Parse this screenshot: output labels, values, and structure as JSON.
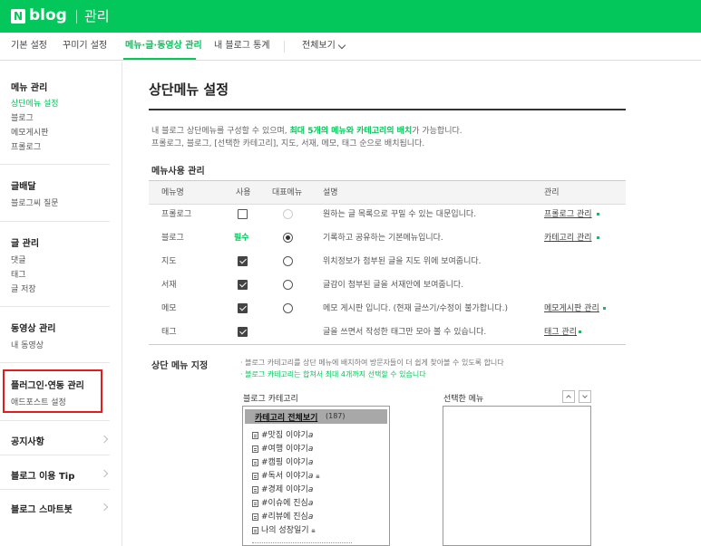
{
  "header": {
    "logo_n": "N",
    "logo_blog": "blog",
    "title": "관리"
  },
  "nav": {
    "tabs": [
      {
        "label": "기본 설정"
      },
      {
        "label": "꾸미기 설정"
      },
      {
        "label": "메뉴·글·동영상 관리"
      },
      {
        "label": "내 블로그 통계"
      },
      {
        "label": "전체보기"
      }
    ],
    "active_index": 2
  },
  "sidebar": {
    "groups": [
      {
        "heading": "메뉴 관리",
        "items": [
          "상단메뉴 설정",
          "블로그",
          "메모게시판",
          "프롤로그"
        ]
      },
      {
        "heading": "글배달",
        "items": [
          "블로그씨 질문"
        ]
      },
      {
        "heading": "글 관리",
        "items": [
          "댓글",
          "태그",
          "글 저장"
        ]
      },
      {
        "heading": "동영상 관리",
        "items": [
          "내 동영상"
        ]
      },
      {
        "heading": "플러그인·연동 관리",
        "items": [
          "애드포스트 설정"
        ]
      }
    ],
    "bottom_links": [
      "공지사항",
      "블로그 이용 Tip",
      "블로그 스마트봇"
    ]
  },
  "main": {
    "title": "상단메뉴 설정",
    "desc1_a": "내 블로그 상단메뉴를 구성할 수 있으며, ",
    "desc1_b": "최대 5개의 메뉴와 카테고리의 배치",
    "desc1_c": "가 가능합니다.",
    "desc2": "프롤로그, 블로그, [선택한 카테고리], 지도, 서재, 메모, 태그 순으로 배치됩니다.",
    "section_title": "메뉴사용 관리",
    "table": {
      "headers": [
        "메뉴명",
        "사용",
        "대표메뉴",
        "설명",
        "관리"
      ],
      "rows": [
        {
          "name": "프롤로그",
          "use": "unchecked",
          "rep": "disabled",
          "desc": "원하는 글 목록으로 꾸밀 수 있는 대문입니다.",
          "manage": "프롤로그 관리"
        },
        {
          "name": "블로그",
          "use": "필수",
          "rep": "selected",
          "desc": "기록하고 공유하는 기본메뉴입니다.",
          "manage": "카테고리 관리"
        },
        {
          "name": "지도",
          "use": "checked",
          "rep": "empty",
          "desc": "위치정보가 첨부된 글을 지도 위에 보여줍니다.",
          "manage": ""
        },
        {
          "name": "서재",
          "use": "checked",
          "rep": "empty",
          "desc": "글감이 첨부된 글을 서재안에 보여줍니다.",
          "manage": ""
        },
        {
          "name": "메모",
          "use": "checked",
          "rep": "empty",
          "desc": "메모 게시판 입니다. (현재 글쓰기/수정이 불가합니다.)",
          "manage": "메모게시판 관리"
        },
        {
          "name": "태그",
          "use": "checked",
          "rep": "none",
          "desc": "글을 쓰면서 작성한 태그만 모아 볼 수 있습니다.",
          "manage": "태그 관리"
        }
      ]
    },
    "section2_title": "상단 메뉴 지정",
    "note1": "· 블로그 카테고리를 상단 메뉴에 배치하여 방문자들이 더 쉽게 찾아볼 수 있도록 합니다",
    "note2": "· 블로그 카테고리는 합쳐서 최대 4개까지 선택할 수 있습니다",
    "category_label": "블로그 카테고리",
    "selected_label": "선택한 메뉴",
    "category_all": "카테고리 전체보기",
    "category_count": "(187)",
    "categories": [
      "#맛집 이야기",
      "#여행 이야기",
      "#캠핑 이야기",
      "#독서 이야기",
      "#경제 이야기",
      "#이슈에 진심",
      "#리뷰에 진심",
      "나의 성장일기"
    ],
    "new_mark": "a"
  },
  "colors": {
    "brand": "#03c75a",
    "highlight": "#e31c1c"
  }
}
